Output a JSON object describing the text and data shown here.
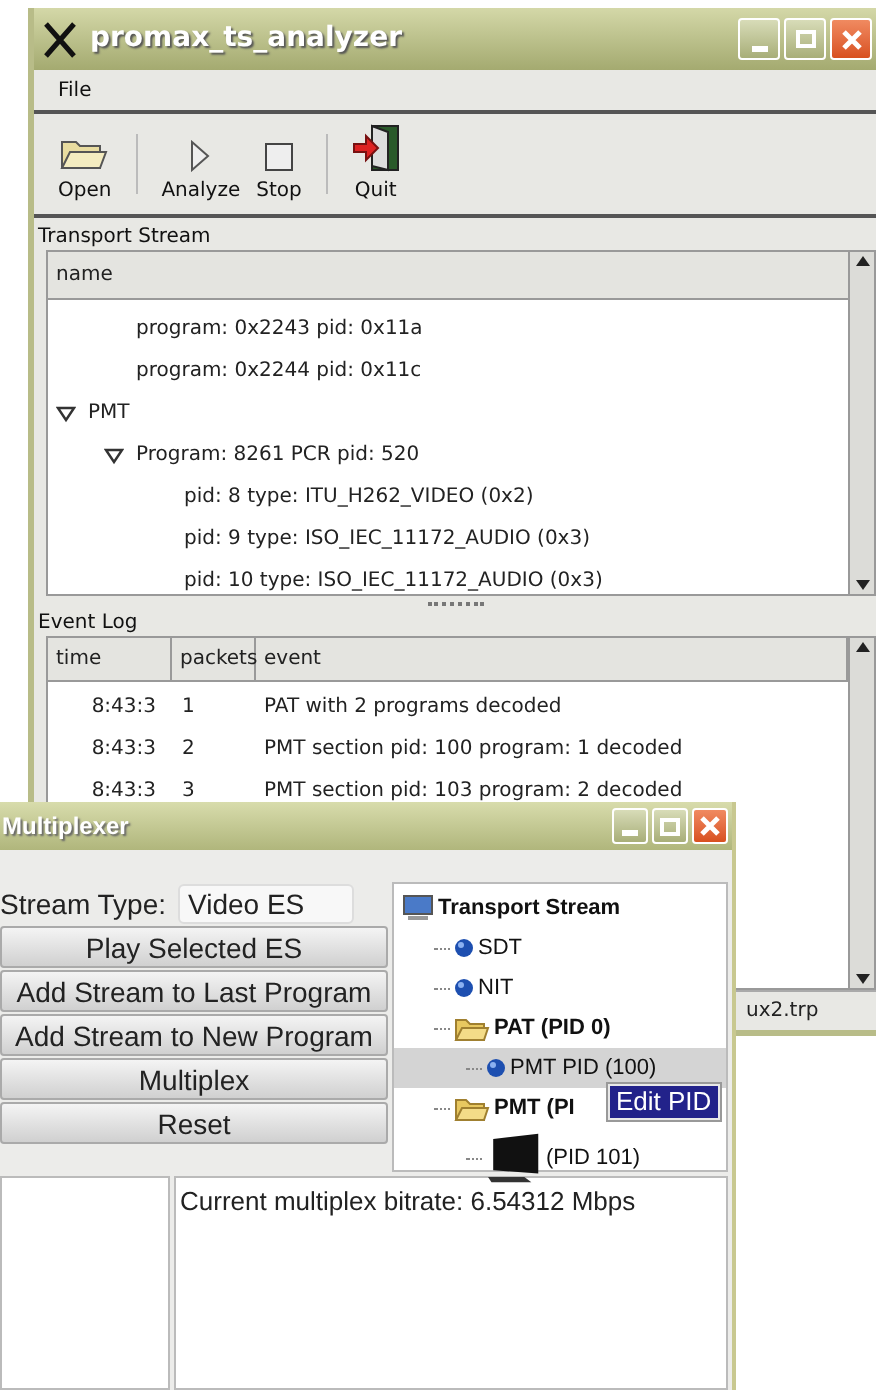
{
  "analyzer": {
    "title": "promax_ts_analyzer",
    "menu": [
      "File"
    ],
    "toolbar": [
      {
        "kind": "open",
        "label": "Open"
      },
      {
        "kind": "analyze",
        "label": "Analyze"
      },
      {
        "kind": "stop",
        "label": "Stop"
      },
      {
        "kind": "quit",
        "label": "Quit"
      }
    ],
    "stream_group": "Transport Stream",
    "tree_column": "name",
    "tree": [
      {
        "children": [
          {
            "label": "program: 0x2243 pid: 0x11a"
          },
          {
            "label": "program: 0x2244 pid: 0x11c"
          }
        ]
      },
      {
        "label": "PMT",
        "expanded": true,
        "children": [
          {
            "label": "Program: 8261 PCR pid: 520",
            "expanded": true,
            "children": [
              {
                "label": "pid: 8 type: ITU_H262_VIDEO (0x2)"
              },
              {
                "label": "pid: 9 type: ISO_IEC_11172_AUDIO (0x3)"
              },
              {
                "label": "pid: 10 type: ISO_IEC_11172_AUDIO (0x3)"
              }
            ]
          }
        ]
      }
    ],
    "log_group": "Event Log",
    "log_columns": [
      "time",
      "packets",
      "event"
    ],
    "log_rows": [
      [
        "8:43:3",
        "1",
        "PAT with 2 programs decoded"
      ],
      [
        "8:43:3",
        "2",
        "PMT section pid: 100 program: 1 decoded"
      ],
      [
        "8:43:3",
        "3",
        "PMT section pid: 103 program: 2 decoded"
      ]
    ],
    "status": "ux2.trp"
  },
  "multiplexer": {
    "title": "Multiplexer",
    "stream_type_label": "Stream Type:",
    "stream_type_value": "Video ES",
    "buttons": [
      "Play Selected ES",
      "Add Stream to Last Program",
      "Add Stream to New Program",
      "Multiplex",
      "Reset"
    ],
    "tree": [
      {
        "kind": "root",
        "label": "Transport Stream",
        "selected": false,
        "children": [
          {
            "kind": "leaf",
            "label": "SDT",
            "selected": false
          },
          {
            "kind": "leaf",
            "label": "NIT",
            "selected": false
          },
          {
            "kind": "folder",
            "label": "PAT (PID 0)",
            "selected": false,
            "children": [
              {
                "kind": "leaf",
                "label": "PMT PID (100)",
                "selected": true
              }
            ]
          },
          {
            "kind": "folder",
            "label": "PMT (PI",
            "selected": false,
            "children": [
              {
                "kind": "monitor",
                "label": "(PID 101)",
                "selected": false
              }
            ]
          }
        ]
      }
    ],
    "popup": "Edit PID",
    "bitrate": "Current multiplex bitrate: 6.54312 Mbps"
  }
}
